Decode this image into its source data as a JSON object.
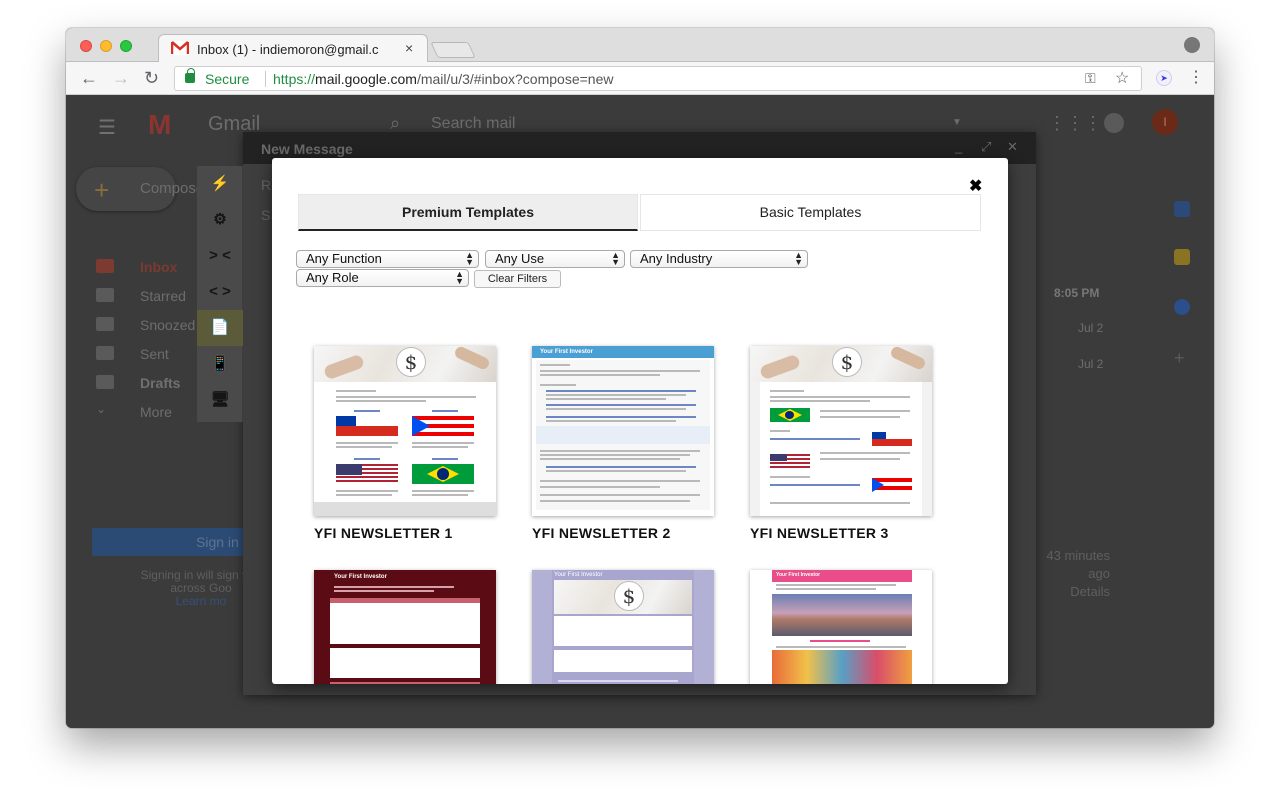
{
  "browser": {
    "tab_title": "Inbox (1) - indiemoron@gmail.c",
    "tab_close": "×",
    "secure_label": "Secure",
    "url_scheme": "https://",
    "url_host": "mail.google.com",
    "url_path": "/mail/u/3/#inbox?compose=new"
  },
  "gmail": {
    "logo": "Gmail",
    "search_placeholder": "Search mail",
    "avatar_initial": "I",
    "compose_label": "Compose",
    "nav": [
      {
        "label": "Inbox"
      },
      {
        "label": "Starred"
      },
      {
        "label": "Snoozed"
      },
      {
        "label": "Sent"
      },
      {
        "label": "Drafts"
      },
      {
        "label": "More"
      }
    ],
    "mail_times": [
      "8:05 PM",
      "Jul 2",
      "Jul 2"
    ],
    "signin_button": "Sign in",
    "signin_text_1": "Signing in will sign you",
    "signin_text_2": "across Goo",
    "signin_link": "Learn mo",
    "activity_1": "43 minutes",
    "activity_2": "ago",
    "activity_3": "Details"
  },
  "compose": {
    "title": "New Message",
    "recipients_label": "R",
    "subject_label": "S",
    "minimize": "_",
    "expand": "⤢",
    "close": "✕"
  },
  "ext_toolbar": [
    "⚡",
    "⚙",
    "> <",
    "< >",
    "📄",
    "📱",
    "🖥"
  ],
  "modal": {
    "close": "✖",
    "tabs": {
      "premium": "Premium Templates",
      "basic": "Basic Templates"
    },
    "filters": {
      "function": "Any Function",
      "use": "Any Use",
      "industry": "Any Industry",
      "role": "Any Role"
    },
    "clear_filters": "Clear Filters",
    "templates": [
      {
        "title": "YFI NEWSLETTER 1"
      },
      {
        "title": "YFI NEWSLETTER 2"
      },
      {
        "title": "YFI NEWSLETTER 3"
      },
      {
        "title": ""
      },
      {
        "title": ""
      },
      {
        "title": ""
      }
    ],
    "thumb_text": {
      "investor": "Your First Investor",
      "dollar": "$"
    }
  }
}
